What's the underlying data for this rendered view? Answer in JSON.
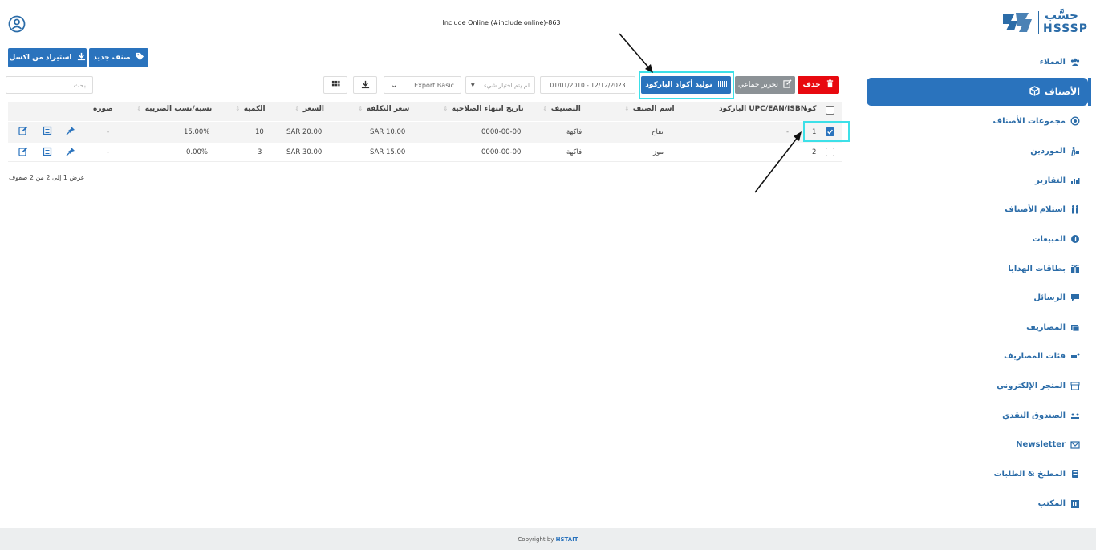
{
  "header": {
    "title": "Include Online (#include online)-863"
  },
  "logo": {
    "arabic": "حسَّب",
    "english": "HSSSP"
  },
  "sidebar": {
    "items": [
      {
        "label": "العملاء",
        "icon": "users-icon"
      },
      {
        "label": "الأصناف",
        "icon": "box-icon",
        "active": true
      },
      {
        "label": "مجموعات الأصناف",
        "icon": "circle-group-icon"
      },
      {
        "label": "الموردين",
        "icon": "supplier-icon"
      },
      {
        "label": "التقارير",
        "icon": "report-icon"
      },
      {
        "label": "استلام الأصناف",
        "icon": "receive-icon"
      },
      {
        "label": "المبيعات",
        "icon": "sales-icon"
      },
      {
        "label": "بطاقات الهدايا",
        "icon": "gift-icon"
      },
      {
        "label": "الرسائل",
        "icon": "message-icon"
      },
      {
        "label": "المصاريف",
        "icon": "expenses-icon"
      },
      {
        "label": "فئات المصاريف",
        "icon": "expense-category-icon"
      },
      {
        "label": "المتجر الإلكتروني",
        "icon": "store-icon"
      },
      {
        "label": "الصندوق النقدي",
        "icon": "cashbox-icon"
      },
      {
        "label": "Newsletter",
        "icon": "newsletter-icon"
      },
      {
        "label": "المطبخ & الطلبات",
        "icon": "kitchen-icon"
      },
      {
        "label": "المكتب",
        "icon": "office-icon"
      }
    ]
  },
  "toolbar": {
    "new_item": "صنف جديد",
    "import_excel": "استيراد من اكسل",
    "delete": "حذف",
    "bulk_edit": "تحرير جماعي",
    "generate_barcodes": "توليد أكواد الباركود",
    "date_range": "01/01/2010 - 12/12/2023",
    "filter_placeholder": "لم يتم اختيار شيء",
    "export": "Export Basic",
    "search_placeholder": "بحث"
  },
  "table": {
    "columns": [
      "كود",
      "UPC/EAN/ISBN الباركود",
      "اسم الصنف",
      "التصنيف",
      "تاريخ انتهاء الصلاحية",
      "سعر التكلفة",
      "السعر",
      "الكمية",
      "نسبة/نسب الضريبة",
      "صورة"
    ],
    "rows": [
      {
        "code": "1",
        "barcode": "-",
        "name": "تفاح",
        "category": "فاكهة",
        "expiry": "0000-00-00",
        "cost": "SAR 10.00",
        "price": "SAR 20.00",
        "qty": "10",
        "tax": "15.00%",
        "image": "-",
        "checked": true
      },
      {
        "code": "2",
        "barcode": "",
        "name": "موز",
        "category": "فاكهة",
        "expiry": "0000-00-00",
        "cost": "SAR 15.00",
        "price": "SAR 30.00",
        "qty": "3",
        "tax": "0.00%",
        "image": "-",
        "checked": false
      }
    ],
    "summary": "عرض 1 إلى 2 من 2 صفوف"
  },
  "footer": {
    "text": "Copyright by",
    "brand": "HSTAIT"
  },
  "colors": {
    "primary": "#2a73bd",
    "danger": "#e8090f",
    "highlight": "#3de0e8",
    "muted": "#8c9296"
  }
}
